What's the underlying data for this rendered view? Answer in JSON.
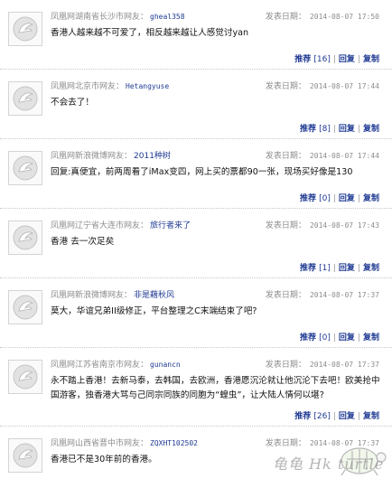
{
  "comments": [
    {
      "source": "凤凰网湖南省长沙市网友：",
      "username": "gheal358",
      "username_cjk": false,
      "date_label": "发表日期：",
      "date": "2014-08-07 17:50",
      "content": "香港人越来越不可爱了，相反越来越让人感觉讨yan",
      "recommend_label": "推荐",
      "count": "16",
      "reply_label": "回复",
      "copy_label": "复制"
    },
    {
      "source": "凤凰网北京市网友：",
      "username": "Hetangyuse",
      "username_cjk": false,
      "date_label": "发表日期：",
      "date": "2014-08-07 17:44",
      "content": "不会去了！",
      "recommend_label": "推荐",
      "count": "8",
      "reply_label": "回复",
      "copy_label": "复制"
    },
    {
      "source": "凤凰网新浪微博网友：",
      "username": "2011种树",
      "username_cjk": true,
      "date_label": "发表日期：",
      "date": "2014-08-07 17:44",
      "content": "回复:真便宜，前两周看了iMax变四，网上买的票都90一张，现场买好像是130",
      "recommend_label": "推荐",
      "count": "0",
      "reply_label": "回复",
      "copy_label": "复制"
    },
    {
      "source": "凤凰网辽宁省大连市网友：",
      "username": "旅行者来了",
      "username_cjk": true,
      "date_label": "发表日期：",
      "date": "2014-08-07 17:43",
      "content": "香港 去一次足矣",
      "recommend_label": "推荐",
      "count": "1",
      "reply_label": "回复",
      "copy_label": "复制"
    },
    {
      "source": "凤凰网新浪微博网友：",
      "username": "非是藉秋风",
      "username_cjk": true,
      "date_label": "发表日期：",
      "date": "2014-08-07 17:37",
      "content": "莫大，华谊兄弟II级修正，平台整理之C末端结束了吧?",
      "recommend_label": "推荐",
      "count": "0",
      "reply_label": "回复",
      "copy_label": "复制"
    },
    {
      "source": "凤凰网江苏省南京市网友：",
      "username": "gunancn",
      "username_cjk": false,
      "date_label": "发表日期：",
      "date": "2014-08-07 17:37",
      "content": "永不踏上香港！去新马泰，去韩国，去欧洲，香港愿沉沦就让他沉沦下去吧！欧美抢中国游客，独香港大骂与己同宗同族的同胞为“蝗虫”，让大陆人情何以堪?",
      "recommend_label": "推荐",
      "count": "26",
      "reply_label": "回复",
      "copy_label": "复制"
    },
    {
      "source": "凤凰网山西省晋中市网友：",
      "username": "ZQXHT102502",
      "username_cjk": false,
      "date_label": "发表日期：",
      "date": "2014-08-07 17:37",
      "content": "香港已不是30年前的香港。",
      "recommend_label": "",
      "count": "",
      "reply_label": "",
      "copy_label": ""
    }
  ],
  "watermark": {
    "text": "龟龟 Hk turtle",
    "color": "#7a7a7a"
  },
  "colors": {
    "link": "#1f3a93",
    "meta": "#8c8c8c",
    "text": "#111111"
  },
  "icons": {
    "avatar": "phoenix-logo-icon"
  }
}
